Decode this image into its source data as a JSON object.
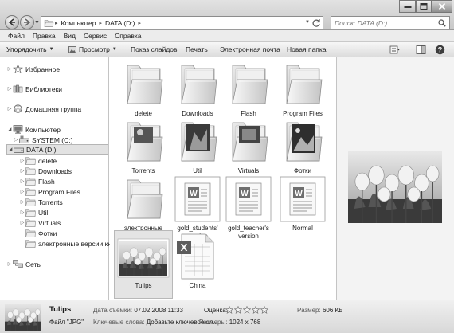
{
  "titlebar": {
    "breadcrumb": [
      "Компьютер",
      "DATA (D:)"
    ],
    "search_placeholder": "Поиск: DATA (D:)"
  },
  "menu": {
    "items": [
      "Файл",
      "Правка",
      "Вид",
      "Сервис",
      "Справка"
    ]
  },
  "toolbar": {
    "organize": "Упорядочить",
    "view": "Просмотр",
    "slideshow": "Показ слайдов",
    "print": "Печать",
    "email": "Электронная почта",
    "new_folder": "Новая папка"
  },
  "sidebar": {
    "favorites": "Избранное",
    "libraries": "Библиотеки",
    "homegroup": "Домашняя группа",
    "computer": "Компьютер",
    "system_drive": "SYSTEM (C:)",
    "data_drive": "DATA (D:)",
    "data_children": [
      "delete",
      "Downloads",
      "Flash",
      "Program Files",
      "Torrents",
      "Util",
      "Virtuals",
      "Фотки",
      "электронные версии книг"
    ],
    "network": "Сеть"
  },
  "files": [
    {
      "name": "delete",
      "type": "folder"
    },
    {
      "name": "Downloads",
      "type": "folder"
    },
    {
      "name": "Flash",
      "type": "folder"
    },
    {
      "name": "Program Files",
      "type": "folder"
    },
    {
      "name": "Torrents",
      "type": "folder-image"
    },
    {
      "name": "Util",
      "type": "folder-image"
    },
    {
      "name": "Virtuals",
      "type": "folder-image"
    },
    {
      "name": "Фотки",
      "type": "folder-image"
    },
    {
      "name": "электронные версии книг",
      "type": "folder"
    },
    {
      "name": "gold_students' version",
      "type": "word"
    },
    {
      "name": "gold_teacher's version",
      "type": "word"
    },
    {
      "name": "Normal",
      "type": "word"
    },
    {
      "name": "Tulips",
      "type": "image"
    },
    {
      "name": "China",
      "type": "excel"
    }
  ],
  "details": {
    "name": "Tulips",
    "file_type": "Файл \"JPG\"",
    "date_label": "Дата съемки:",
    "date_value": "07.02.2008 11:33",
    "keywords_label": "Ключевые слова:",
    "keywords_value": "Добавьте ключевое сл...",
    "rating_label": "Оценка:",
    "dimensions_label": "Размеры:",
    "dimensions_value": "1024 x 768",
    "size_label": "Размер:",
    "size_value": "606 КБ",
    "rating": 0,
    "rating_max": 5
  }
}
